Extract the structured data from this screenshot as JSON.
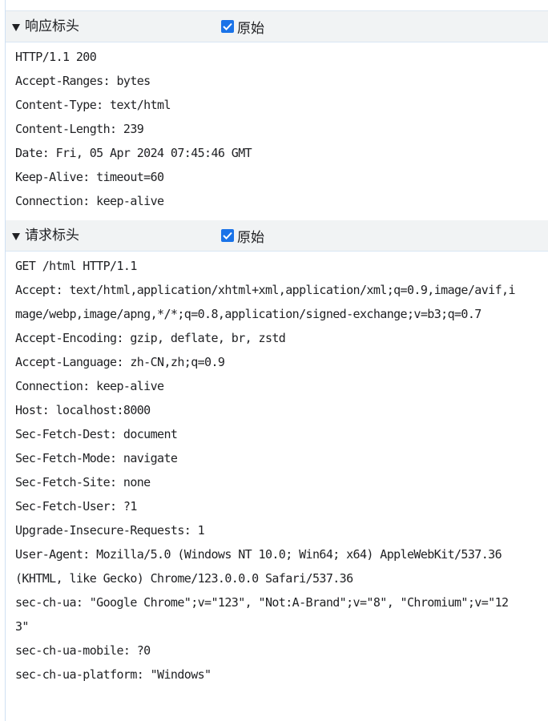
{
  "response_section": {
    "title": "响应标头",
    "raw_label": "原始",
    "raw_checked": true,
    "lines": [
      "HTTP/1.1 200",
      "Accept-Ranges: bytes",
      "Content-Type: text/html",
      "Content-Length: 239",
      "Date: Fri, 05 Apr 2024 07:45:46 GMT",
      "Keep-Alive: timeout=60",
      "Connection: keep-alive"
    ]
  },
  "request_section": {
    "title": "请求标头",
    "raw_label": "原始",
    "raw_checked": true,
    "lines": [
      "GET /html HTTP/1.1",
      "Accept: text/html,application/xhtml+xml,application/xml;q=0.9,image/avif,i",
      "mage/webp,image/apng,*/*;q=0.8,application/signed-exchange;v=b3;q=0.7",
      "Accept-Encoding: gzip, deflate, br, zstd",
      "Accept-Language: zh-CN,zh;q=0.9",
      "Connection: keep-alive",
      "Host: localhost:8000",
      "Sec-Fetch-Dest: document",
      "Sec-Fetch-Mode: navigate",
      "Sec-Fetch-Site: none",
      "Sec-Fetch-User: ?1",
      "Upgrade-Insecure-Requests: 1",
      "User-Agent: Mozilla/5.0 (Windows NT 10.0; Win64; x64) AppleWebKit/537.36",
      "(KHTML, like Gecko) Chrome/123.0.0.0 Safari/537.36",
      "sec-ch-ua: \"Google Chrome\";v=\"123\", \"Not:A-Brand\";v=\"8\", \"Chromium\";v=\"12",
      "3\"",
      "sec-ch-ua-mobile: ?0",
      "sec-ch-ua-platform: \"Windows\""
    ]
  },
  "colors": {
    "header_bg": "#f1f3f4",
    "checkbox_accent": "#1a73e8",
    "border": "#d9e6f4"
  },
  "icons": {
    "section_toggle": "triangle-down-icon",
    "checkbox": "checkbox-checked-icon"
  }
}
